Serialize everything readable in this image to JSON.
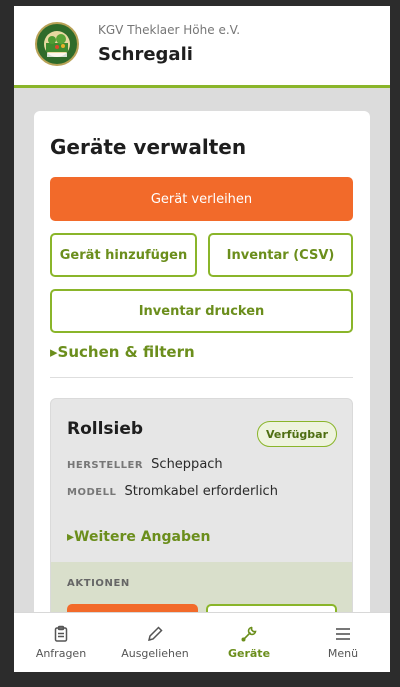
{
  "header": {
    "club_name": "KGV Theklaer Höhe e.V.",
    "app_title": "Schregali",
    "logo_icon": "club-logo-icon"
  },
  "card": {
    "title": "Geräte verwalten",
    "lend_button": "Gerät verleihen",
    "add_button": "Gerät hinzufügen",
    "csv_button": "Inventar (CSV)",
    "print_button": "Inventar drucken",
    "filter_toggle": "▸Suchen & filtern"
  },
  "item": {
    "name": "Rollsieb",
    "status": "Verfügbar",
    "attrs": [
      {
        "key": "HERSTELLER",
        "value": "Scheppach"
      },
      {
        "key": "MODELL",
        "value": "Stromkabel erforderlich"
      }
    ],
    "more_toggle": "▸Weitere Angaben",
    "actions_label": "AKTIONEN"
  },
  "tabs": [
    {
      "label": "Anfragen",
      "icon": "clipboard-icon"
    },
    {
      "label": "Ausgeliehen",
      "icon": "pencil-icon"
    },
    {
      "label": "Geräte",
      "icon": "wrench-icon"
    },
    {
      "label": "Menü",
      "icon": "menu-icon"
    }
  ],
  "colors": {
    "accent": "#f26a2a",
    "brand_green": "#8ab52a",
    "text_green": "#6b8e1c"
  }
}
